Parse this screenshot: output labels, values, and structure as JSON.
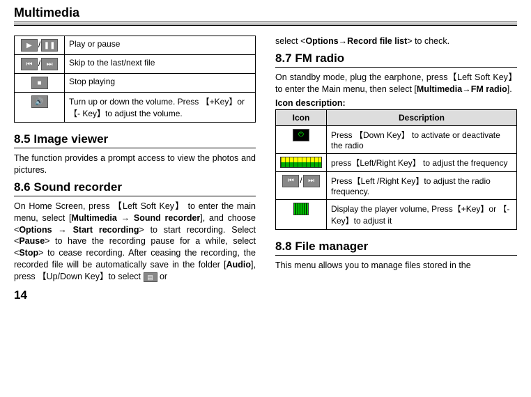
{
  "header": "Multimedia",
  "page_number": "14",
  "left": {
    "table": [
      {
        "icon": "play-pause",
        "desc": "Play or pause"
      },
      {
        "icon": "prev-next",
        "desc": "Skip to the last/next file"
      },
      {
        "icon": "stop",
        "desc": "Stop playing"
      },
      {
        "icon": "volume",
        "desc": "Turn up or down the volume. Press 【+Key】or 【- Key】to adjust the volume."
      }
    ],
    "s85_title": "8.5 Image viewer",
    "s85_para": "The function provides a prompt access to view the photos and pictures.",
    "s86_title": "8.6 Sound recorder",
    "s86_para_parts": {
      "a": "On Home Screen, press 【Left Soft Key】 to enter the main menu, select [",
      "b": "Multimedia → Sound recorder",
      "c": "], and choose <",
      "d": "Options → Start recording",
      "e": "> to start recording. Select <",
      "f": "Pause",
      "g": "> to have the recording pause for a while, select <",
      "h": "Stop",
      "i": "> to cease recording. After ceasing the recording, the recorded file will be automatically save in the folder [",
      "j": "Audio",
      "k": "], press 【Up/Down Key】to select ",
      "l": " or"
    }
  },
  "right": {
    "intro_parts": {
      "a": "select <",
      "b": "Options→Record file list",
      "c": "> to check."
    },
    "s87_title": "8.7 FM radio",
    "s87_para_parts": {
      "a": "On standby mode, plug the earphone, press【Left Soft Key】 to enter the Main menu, then select [",
      "b": "Multimedia→FM radio",
      "c": "]."
    },
    "icon_desc_label": "Icon description:",
    "th_icon": "Icon",
    "th_desc": "Description",
    "rows": [
      {
        "icon": "power",
        "desc": "Press 【Down Key】 to activate or deactivate the radio"
      },
      {
        "icon": "tuner",
        "desc": "press【Left/Right Key】 to adjust the frequency"
      },
      {
        "icon": "prev-next",
        "desc": "Press【Left /Right Key】to adjust the radio frequency."
      },
      {
        "icon": "eq",
        "desc": "Display the player volume, Press【+Key】or 【- Key】to adjust it"
      }
    ],
    "s88_title": "8.8 File manager",
    "s88_para": "This menu allows you to manage files stored in the"
  }
}
